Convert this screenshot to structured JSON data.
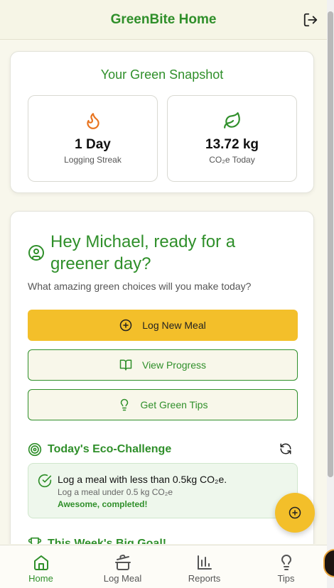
{
  "header": {
    "title": "GreenBite Home",
    "logout_icon": "logout-icon"
  },
  "snapshot": {
    "title": "Your Green Snapshot",
    "streak": {
      "value": "1 Day",
      "label": "Logging Streak",
      "icon": "flame-icon"
    },
    "co2": {
      "value": "13.72 kg",
      "label": "CO₂e Today",
      "icon": "leaf-icon"
    }
  },
  "welcome": {
    "greeting": "Hey Michael, ready for a greener day?",
    "subtitle": "What amazing green choices will you make today?",
    "buttons": {
      "log_meal": "Log New Meal",
      "view_progress": "View Progress",
      "get_tips": "Get Green Tips"
    }
  },
  "challenge": {
    "title": "Today's Eco-Challenge",
    "main": "Log a meal with less than 0.5kg CO₂e.",
    "sub": "Log a meal under 0.5 kg CO₂e",
    "status": "Awesome, completed!"
  },
  "goal": {
    "title": "This Week's Big Goal!"
  },
  "nav": [
    {
      "label": "Home",
      "icon": "home-icon",
      "active": true
    },
    {
      "label": "Log Meal",
      "icon": "pot-icon",
      "active": false
    },
    {
      "label": "Reports",
      "icon": "bar-chart-icon",
      "active": false
    },
    {
      "label": "Tips",
      "icon": "lightbulb-icon",
      "active": false
    }
  ],
  "colors": {
    "brand_green": "#2f8f2a",
    "accent_yellow": "#f3bf2a",
    "background": "#f8f7ec"
  }
}
